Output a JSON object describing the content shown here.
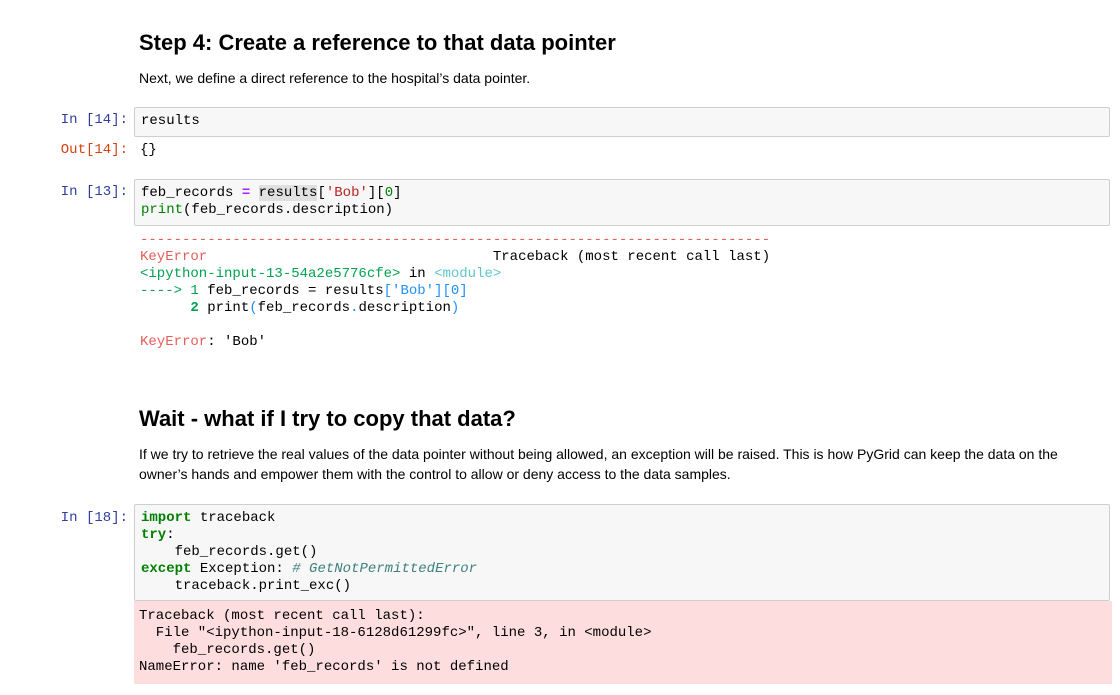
{
  "step4": {
    "heading": "Step 4: Create a reference to that data pointer",
    "desc": "Next, we define a direct reference to the hospital’s data pointer."
  },
  "cell14": {
    "prompt_in": "In [14]:",
    "prompt_out": "Out[14]:",
    "code": "results",
    "output": "{}"
  },
  "cell13": {
    "prompt_in": "In [13]:",
    "line1": {
      "var": "feb_records ",
      "op": "=",
      "sp": " ",
      "ref": "results",
      "p1": "[",
      "key": "'Bob'",
      "p2": "][",
      "idx": "0",
      "p3": "]"
    },
    "line2": {
      "fn": "print",
      "arg": "(feb_records.description)"
    },
    "traceback": {
      "dashes": "---------------------------------------------------------------------------",
      "error_name": "KeyError",
      "header_right": "                                  Traceback (most recent call last)",
      "input_name": "<ipython-input-13-54a2e5776cfe>",
      "in_word": " in ",
      "module": "<module>",
      "arrow": "----> 1",
      "arrow_code_a": " feb_records = results",
      "arrow_key": "['Bob'",
      "arrow_idx": "][0]",
      "line2_num": "      2",
      "line2_a": " print",
      "line2_b": "(",
      "line2_c": "feb_records",
      "line2_d": ".",
      "line2_e": "description",
      "line2_f": ")",
      "final_name": "KeyError",
      "final_msg": ": 'Bob'"
    }
  },
  "wait": {
    "heading": "Wait - what if I try to copy that data?",
    "desc": "If we try to retrieve the real values of the data pointer without being allowed, an exception will be raised. This is how PyGrid can keep the data on the owner’s hands and empower them with the control to allow or deny access to the data samples."
  },
  "cell18": {
    "prompt_in": "In [18]:",
    "l1_kw": "import",
    "l1_rest": " traceback",
    "l2_kw": "try",
    "l2_rest": ":",
    "l3": "    feb_records.get()",
    "l4_kw": "except",
    "l4_rest": " Exception: ",
    "l4_comment": "# GetNotPermittedError",
    "l5": "    traceback.print_exc()",
    "stderr": "Traceback (most recent call last):\n  File \"<ipython-input-18-6128d61299fc>\", line 3, in <module>\n    feb_records.get()\nNameError: name 'feb_records' is not defined"
  }
}
